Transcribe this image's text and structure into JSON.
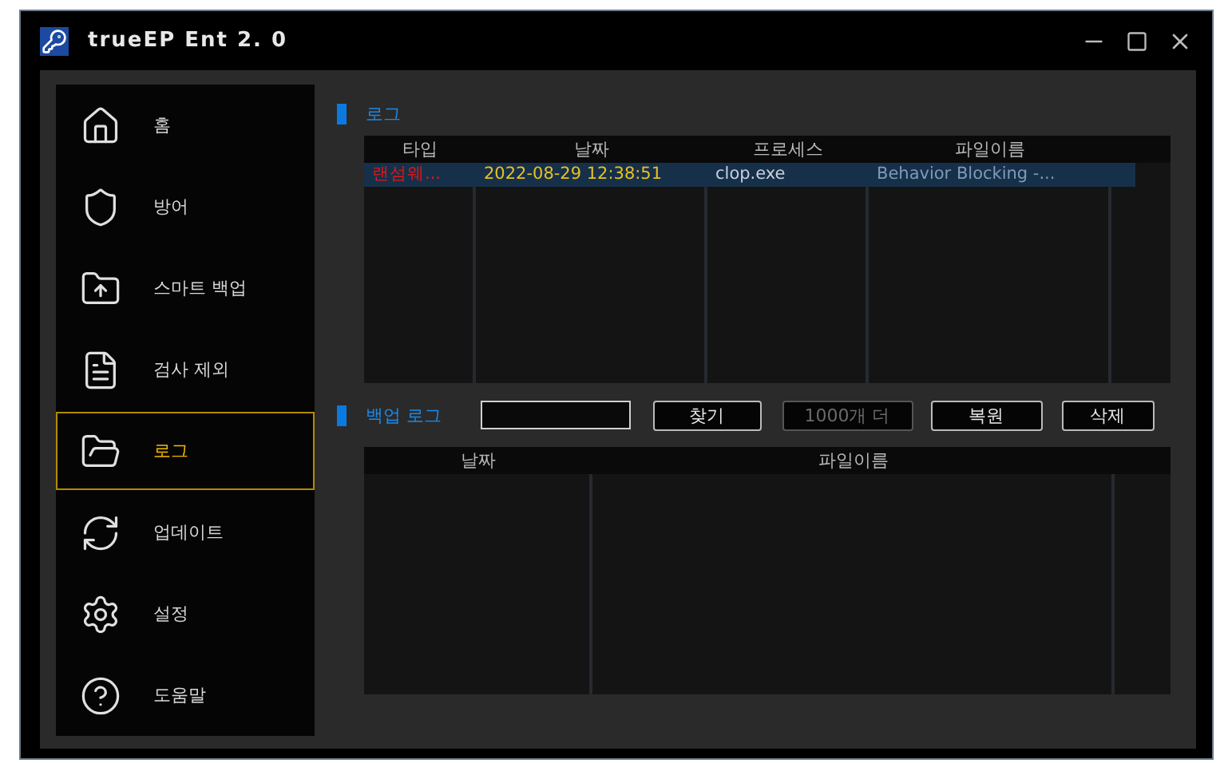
{
  "window": {
    "title": "trueEP Ent 2. 0"
  },
  "sidebar": {
    "items": [
      {
        "label": "홈",
        "selected": false
      },
      {
        "label": "방어",
        "selected": false
      },
      {
        "label": "스마트 백업",
        "selected": false
      },
      {
        "label": "검사 제외",
        "selected": false
      },
      {
        "label": "로그",
        "selected": true
      },
      {
        "label": "업데이트",
        "selected": false
      },
      {
        "label": "설정",
        "selected": false
      },
      {
        "label": "도움말",
        "selected": false
      }
    ]
  },
  "log": {
    "title": "로그",
    "table": {
      "columns": [
        "타입",
        "날짜",
        "프로세스",
        "파일이름"
      ],
      "rows": [
        {
          "cells": [
            "랜섬웨...",
            "2022-08-29 12:38:51",
            "clop.exe",
            "Behavior Blocking -..."
          ],
          "selected": true
        }
      ]
    }
  },
  "backup_log": {
    "title": "백업 로그",
    "buttons": [
      {
        "label": "찾기",
        "disabled": false
      },
      {
        "label": "1000개 더",
        "disabled": true
      },
      {
        "label": "복원",
        "disabled": false
      },
      {
        "label": "삭제",
        "disabled": false
      }
    ],
    "table": {
      "columns": [
        "날짜",
        "파일이름"
      ]
    }
  }
}
